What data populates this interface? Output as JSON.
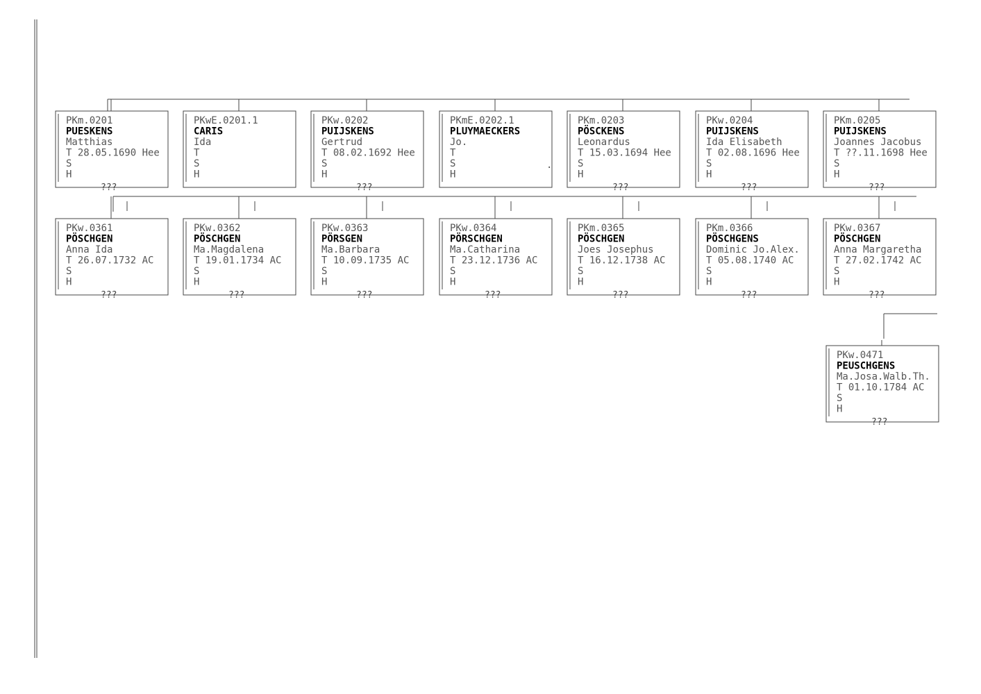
{
  "rows": [
    [
      {
        "id": "PKm.0201",
        "surname": "PUESKENS",
        "given": "Matthias",
        "t": "T 28.05.1690 Hee",
        "s": "S",
        "h": "H",
        "bottom": "???"
      },
      {
        "id": "PKwE.0201.1",
        "surname": "CARIS",
        "given": "Ida",
        "t": "T",
        "s": "S",
        "h": "H",
        "bottom": ""
      },
      {
        "id": "PKw.0202",
        "surname": "PUIJSKENS",
        "given": "Gertrud",
        "t": "T 08.02.1692 Hee",
        "s": "S",
        "h": "H",
        "bottom": "???"
      },
      {
        "id": "PKmE.0202.1",
        "surname": "PLUYMAECKERS",
        "given": "Jo.",
        "t": "T",
        "s": "S",
        "h": "H",
        "bottom": ""
      },
      {
        "id": "PKm.0203",
        "surname": "PÖSCKENS",
        "given": "Leonardus",
        "t": "T 15.03.1694 Hee",
        "s": "S",
        "h": "H",
        "bottom": "???"
      },
      {
        "id": "PKw.0204",
        "surname": "PUIJSKENS",
        "given": "Ida Elisabeth",
        "t": "T 02.08.1696 Hee",
        "s": "S",
        "h": "H",
        "bottom": "???"
      },
      {
        "id": "PKm.0205",
        "surname": "PUIJSKENS",
        "given": "Joannes Jacobus",
        "t": "T ??.11.1698 Hee",
        "s": "S",
        "h": "H",
        "bottom": "???"
      }
    ],
    [
      {
        "id": "PKw.0361",
        "surname": "PÖSCHGEN",
        "given": "Anna Ida",
        "t": "T 26.07.1732 AC",
        "s": "S",
        "h": "H",
        "bottom": "???"
      },
      {
        "id": "PKw.0362",
        "surname": "PÖSCHGEN",
        "given": "Ma.Magdalena",
        "t": "T 19.01.1734 AC",
        "s": "S",
        "h": "H",
        "bottom": "???"
      },
      {
        "id": "PKw.0363",
        "surname": "PÖRSGEN",
        "given": "Ma.Barbara",
        "t": "T 10.09.1735 AC",
        "s": "S",
        "h": "H",
        "bottom": "???"
      },
      {
        "id": "PKw.0364",
        "surname": "PÖRSCHGEN",
        "given": "Ma.Catharina",
        "t": "T 23.12.1736 AC",
        "s": "S",
        "h": "H",
        "bottom": "???"
      },
      {
        "id": "PKm.0365",
        "surname": "PÖSCHGEN",
        "given": "Joes Josephus",
        "t": "T 16.12.1738 AC",
        "s": "S",
        "h": "H",
        "bottom": "???"
      },
      {
        "id": "PKm.0366",
        "surname": "PÖSCHGENS",
        "given": "Dominic Jo.Alex.",
        "t": "T 05.08.1740 AC",
        "s": "S",
        "h": "H",
        "bottom": "???"
      },
      {
        "id": "PKw.0367",
        "surname": "PÖSCHGEN",
        "given": "Anna Margaretha",
        "t": "T 27.02.1742 AC",
        "s": "S",
        "h": "H",
        "bottom": "???"
      }
    ],
    [
      {
        "id": "PKw.0471",
        "surname": "PEUSCHGENS",
        "given": "Ma.Josa.Walb.Th.",
        "t": "T 01.10.1784 AC",
        "s": "S",
        "h": "H",
        "bottom": "???"
      }
    ]
  ],
  "dot": "."
}
